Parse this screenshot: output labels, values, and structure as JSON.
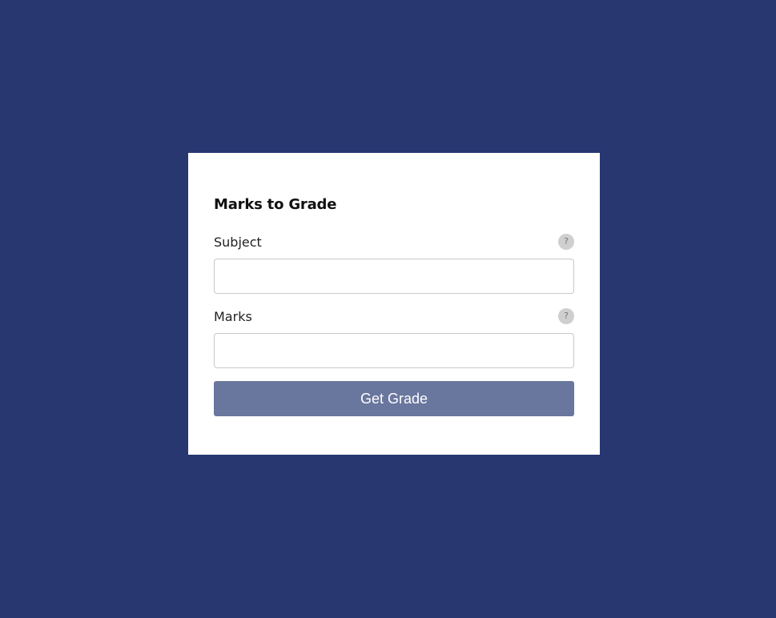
{
  "colors": {
    "page_background": "#283770",
    "card_background": "#ffffff",
    "button_background": "#69769e",
    "help_icon_background": "#cfcfcf"
  },
  "form": {
    "title": "Marks to Grade",
    "fields": [
      {
        "label": "Subject",
        "help_icon": "question-mark-icon",
        "help_glyph": "?",
        "value": "",
        "placeholder": ""
      },
      {
        "label": "Marks",
        "help_icon": "question-mark-icon",
        "help_glyph": "?",
        "value": "",
        "placeholder": ""
      }
    ],
    "submit_label": "Get Grade"
  }
}
